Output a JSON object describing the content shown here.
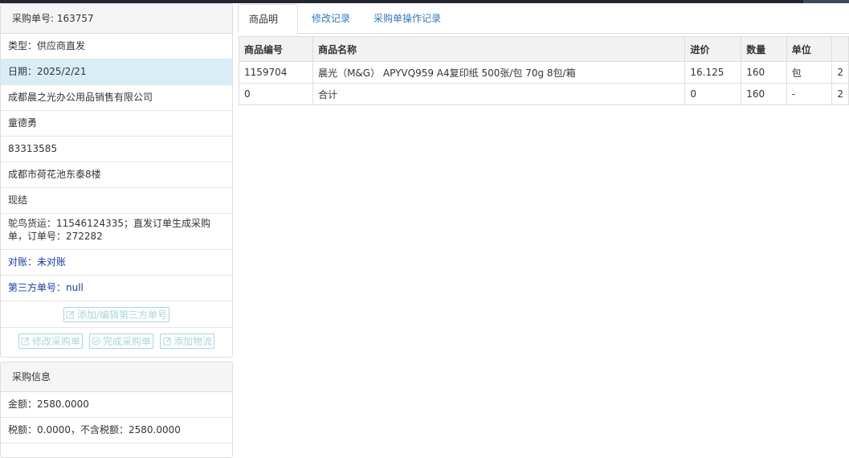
{
  "order": {
    "header": "采购单号: 163757",
    "rows": [
      {
        "text": "类型：供应商直发",
        "active": false
      },
      {
        "text": "日期：2025/2/21",
        "active": true
      },
      {
        "text": "成都晨之光办公用品销售有限公司",
        "active": false
      },
      {
        "text": "童德勇",
        "active": false
      },
      {
        "text": "83313585",
        "active": false
      },
      {
        "text": "成都市荷花池东泰8楼",
        "active": false
      },
      {
        "text": "现结",
        "active": false
      }
    ],
    "note": "鸵鸟货运：11546124335；直发订单生成采购单，订单号：272282",
    "reconcile": "对账：未对账",
    "third_party_no": "第三方单号：null",
    "buttons": {
      "edit_third_party": "添加/编辑第三方单号",
      "modify": "修改采购单",
      "complete": "完成采购单",
      "add_logistics": "添加物流"
    }
  },
  "purchase_info": {
    "header": "采购信息",
    "amount": "金额：2580.0000",
    "tax": "税额：0.0000，不含税额：2580.0000"
  },
  "tabs": [
    {
      "label": "商品明细",
      "active": true
    },
    {
      "label": "修改记录",
      "active": false
    },
    {
      "label": "采购单操作记录",
      "active": false
    }
  ],
  "table": {
    "headers": [
      "商品编号",
      "商品名称",
      "进价",
      "数量",
      "单位",
      ""
    ],
    "rows": [
      [
        "1159704",
        "晨光（M&G） APYVQ959 A4复印纸 500张/包 70g 8包/箱",
        "16.125",
        "160",
        "包",
        "2"
      ],
      [
        "0",
        "合计",
        "0",
        "160",
        "-",
        "2"
      ]
    ]
  }
}
